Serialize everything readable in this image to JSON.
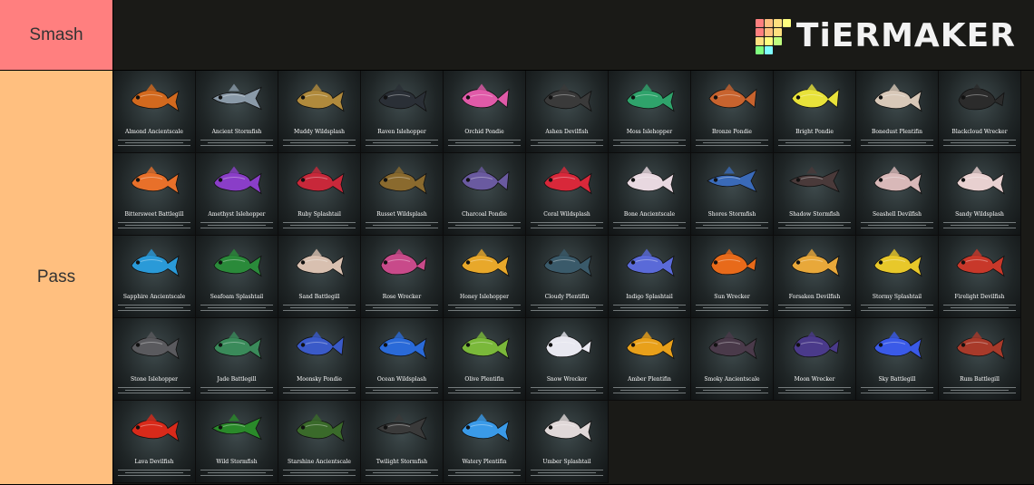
{
  "tiers": [
    {
      "label": "Smash",
      "color": "#ff7f7f",
      "items": []
    },
    {
      "label": "Pass",
      "color": "#ffbf7f",
      "items": [
        {
          "name": "Almond Ancientscale",
          "color": "#d2691e",
          "icon": "fish-icon"
        },
        {
          "name": "Ancient Stormfish",
          "color": "#8a9aa8",
          "icon": "stormfish-icon"
        },
        {
          "name": "Muddy Wildsplash",
          "color": "#b08a3c",
          "icon": "fish-icon"
        },
        {
          "name": "Raven Islehopper",
          "color": "#2a2f36",
          "icon": "islehopper-icon"
        },
        {
          "name": "Orchid Pondie",
          "color": "#e05aa8",
          "icon": "pondie-icon"
        },
        {
          "name": "Ashen Devilfish",
          "color": "#3a3a3a",
          "icon": "devilfish-icon"
        },
        {
          "name": "Moss Islehopper",
          "color": "#2fa36b",
          "icon": "islehopper-icon"
        },
        {
          "name": "Bronze Pondie",
          "color": "#c8632e",
          "icon": "pondie-icon"
        },
        {
          "name": "Bright Pondie",
          "color": "#e8e23a",
          "icon": "pondie-icon"
        },
        {
          "name": "Bonedust Plentifin",
          "color": "#d8c8b8",
          "icon": "plentifin-icon"
        },
        {
          "name": "Blackcloud Wrecker",
          "color": "#2b2b2b",
          "icon": "wrecker-icon"
        },
        {
          "name": "Bittersweet Battlegill",
          "color": "#e8702a",
          "icon": "battlegill-icon"
        },
        {
          "name": "Amethyst Islehopper",
          "color": "#8a3ec8",
          "icon": "islehopper-icon"
        },
        {
          "name": "Ruby Splashtail",
          "color": "#c8283a",
          "icon": "splashtail-icon"
        },
        {
          "name": "Russet Wildsplash",
          "color": "#8a6a2e",
          "icon": "fish-icon"
        },
        {
          "name": "Charcoal Pondie",
          "color": "#6a5aa0",
          "icon": "pondie-icon"
        },
        {
          "name": "Coral Wildsplash",
          "color": "#d8283a",
          "icon": "fish-icon"
        },
        {
          "name": "Bone Ancientscale",
          "color": "#e8d8e0",
          "icon": "fish-icon"
        },
        {
          "name": "Shores Stormfish",
          "color": "#3a6ab8",
          "icon": "stormfish-icon"
        },
        {
          "name": "Shadow Stormfish",
          "color": "#4a3a3a",
          "icon": "stormfish-icon"
        },
        {
          "name": "Seashell Devilfish",
          "color": "#d8b8b8",
          "icon": "devilfish-icon"
        },
        {
          "name": "Sandy Wildsplash",
          "color": "#e8d0d0",
          "icon": "fish-icon"
        },
        {
          "name": "Sapphire Ancientscale",
          "color": "#2a9ad8",
          "icon": "fish-icon"
        },
        {
          "name": "Seafoam Splashtail",
          "color": "#2a8a3a",
          "icon": "splashtail-icon"
        },
        {
          "name": "Sand Battlegill",
          "color": "#d8c0b0",
          "icon": "battlegill-icon"
        },
        {
          "name": "Rose Wrecker",
          "color": "#c84a8a",
          "icon": "wrecker-icon"
        },
        {
          "name": "Honey Islehopper",
          "color": "#e8a82a",
          "icon": "islehopper-icon"
        },
        {
          "name": "Cloudy Plentifin",
          "color": "#3a5a6a",
          "icon": "plentifin-icon"
        },
        {
          "name": "Indigo Splashtail",
          "color": "#5a6ad8",
          "icon": "splashtail-icon"
        },
        {
          "name": "Sun Wrecker",
          "color": "#e86a1a",
          "icon": "wrecker-icon"
        },
        {
          "name": "Forsaken Devilfish",
          "color": "#e8a83a",
          "icon": "devilfish-icon"
        },
        {
          "name": "Stormy Splashtail",
          "color": "#e8c82a",
          "icon": "splashtail-icon"
        },
        {
          "name": "Firelight Devilfish",
          "color": "#c8382a",
          "icon": "devilfish-icon"
        },
        {
          "name": "Stone Islehopper",
          "color": "#5a5a5e",
          "icon": "islehopper-icon"
        },
        {
          "name": "Jade Battlegill",
          "color": "#3a8a5a",
          "icon": "battlegill-icon"
        },
        {
          "name": "Moonsky Pondie",
          "color": "#3a5ac8",
          "icon": "pondie-icon"
        },
        {
          "name": "Ocean Wildsplash",
          "color": "#2a6ad8",
          "icon": "fish-icon"
        },
        {
          "name": "Olive Plentifin",
          "color": "#7ab83a",
          "icon": "plentifin-icon"
        },
        {
          "name": "Snow Wrecker",
          "color": "#e8e8f0",
          "icon": "wrecker-icon"
        },
        {
          "name": "Amber Plentifin",
          "color": "#e8a01a",
          "icon": "plentifin-icon"
        },
        {
          "name": "Smoky Ancientscale",
          "color": "#4a3a4a",
          "icon": "fish-icon"
        },
        {
          "name": "Moon Wrecker",
          "color": "#4a3a8a",
          "icon": "wrecker-icon"
        },
        {
          "name": "Sky Battlegill",
          "color": "#3a5ae8",
          "icon": "battlegill-icon"
        },
        {
          "name": "Rum Battlegill",
          "color": "#a83a2a",
          "icon": "battlegill-icon"
        },
        {
          "name": "Lava Devilfish",
          "color": "#d82a1a",
          "icon": "devilfish-icon"
        },
        {
          "name": "Wild Stormfish",
          "color": "#2a8a2a",
          "icon": "stormfish-icon"
        },
        {
          "name": "Starshine Ancientscale",
          "color": "#3a6a2a",
          "icon": "fish-icon"
        },
        {
          "name": "Twilight Stormfish",
          "color": "#3a3a3a",
          "icon": "stormfish-icon"
        },
        {
          "name": "Watery Plentifin",
          "color": "#3a9ae8",
          "icon": "plentifin-icon"
        },
        {
          "name": "Umber Splashtail",
          "color": "#e0d8d8",
          "icon": "splashtail-icon"
        }
      ]
    }
  ],
  "logo": {
    "text": "TiERMAKER",
    "colors": [
      "#ff7f7f",
      "#ffbf7f",
      "#ffdf7f",
      "#ffff7f",
      "#ff7f7f",
      "#ffbf7f",
      "#ffdf7f",
      "#1a1a17",
      "#ffdf7f",
      "#ffff7f",
      "#bfff7f",
      "#1a1a17",
      "#7fff7f",
      "#7fffff",
      "#1a1a17",
      "#1a1a17"
    ]
  }
}
